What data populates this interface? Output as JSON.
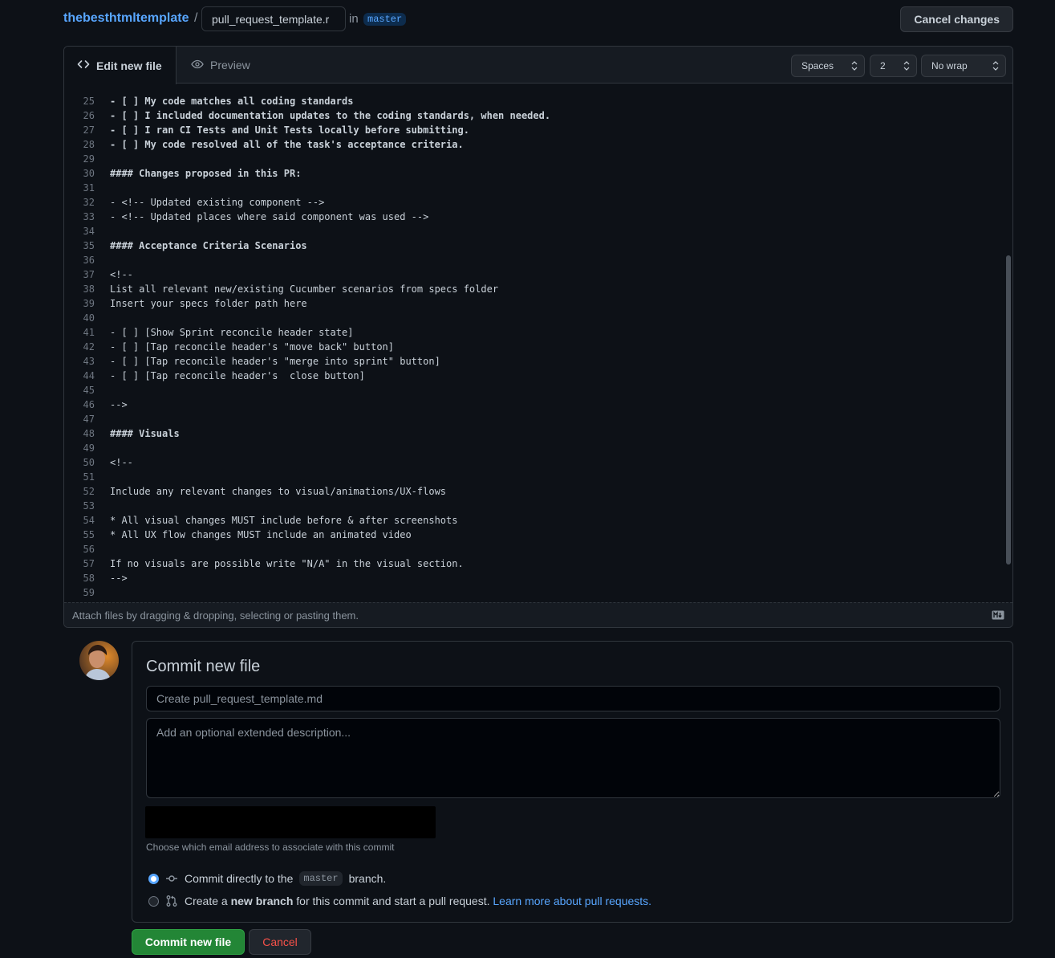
{
  "breadcrumb": {
    "repo": "thebesthtmltemplate",
    "separator": "/",
    "filename_value": "pull_request_template.r",
    "in_label": "in",
    "branch": "master"
  },
  "header": {
    "cancel_changes": "Cancel changes"
  },
  "editor": {
    "tab_edit": "Edit new file",
    "tab_preview": "Preview",
    "indent_mode": "Spaces",
    "indent_size": "2",
    "wrap_mode": "No wrap",
    "lines": [
      {
        "n": "25",
        "t": "- [ ] My code matches all coding standards",
        "bold": true
      },
      {
        "n": "26",
        "t": "- [ ] I included documentation updates to the coding standards, when needed.",
        "bold": true
      },
      {
        "n": "27",
        "t": "- [ ] I ran CI Tests and Unit Tests locally before submitting.",
        "bold": true
      },
      {
        "n": "28",
        "t": "- [ ] My code resolved all of the task's acceptance criteria.",
        "bold": true
      },
      {
        "n": "29",
        "t": ""
      },
      {
        "n": "30",
        "t": "#### Changes proposed in this PR:",
        "bold": true
      },
      {
        "n": "31",
        "t": ""
      },
      {
        "n": "32",
        "t": "- <!-- Updated existing component -->"
      },
      {
        "n": "33",
        "t": "- <!-- Updated places where said component was used -->"
      },
      {
        "n": "34",
        "t": ""
      },
      {
        "n": "35",
        "t": "#### Acceptance Criteria Scenarios",
        "bold": true
      },
      {
        "n": "36",
        "t": ""
      },
      {
        "n": "37",
        "t": "<!--"
      },
      {
        "n": "38",
        "t": "List all relevant new/existing Cucumber scenarios from specs folder"
      },
      {
        "n": "39",
        "t": "Insert your specs folder path here"
      },
      {
        "n": "40",
        "t": ""
      },
      {
        "n": "41",
        "t": "- [ ] [Show Sprint reconcile header state]"
      },
      {
        "n": "42",
        "t": "- [ ] [Tap reconcile header's \"move back\" button]"
      },
      {
        "n": "43",
        "t": "- [ ] [Tap reconcile header's \"merge into sprint\" button]"
      },
      {
        "n": "44",
        "t": "- [ ] [Tap reconcile header's  close button]"
      },
      {
        "n": "45",
        "t": ""
      },
      {
        "n": "46",
        "t": "-->"
      },
      {
        "n": "47",
        "t": ""
      },
      {
        "n": "48",
        "t": "#### Visuals",
        "bold": true
      },
      {
        "n": "49",
        "t": ""
      },
      {
        "n": "50",
        "t": "<!--"
      },
      {
        "n": "51",
        "t": ""
      },
      {
        "n": "52",
        "t": "Include any relevant changes to visual/animations/UX-flows"
      },
      {
        "n": "53",
        "t": ""
      },
      {
        "n": "54",
        "t": "* All visual changes MUST include before & after screenshots"
      },
      {
        "n": "55",
        "t": "* All UX flow changes MUST include an animated video"
      },
      {
        "n": "56",
        "t": ""
      },
      {
        "n": "57",
        "t": "If no visuals are possible write \"N/A\" in the visual section."
      },
      {
        "n": "58",
        "t": "-->"
      },
      {
        "n": "59",
        "t": ""
      }
    ],
    "attach_hint": "Attach files by dragging & dropping, selecting or pasting them."
  },
  "commit": {
    "title": "Commit new file",
    "summary_placeholder": "Create pull_request_template.md",
    "description_placeholder": "Add an optional extended description...",
    "email_note": "Choose which email address to associate with this commit",
    "option_direct_pre": "Commit directly to the",
    "option_direct_branch": "master",
    "option_direct_post": "branch.",
    "option_new_pre": "Create a",
    "option_new_bold": "new branch",
    "option_new_post": "for this commit and start a pull request.",
    "option_new_link": "Learn more about pull requests.",
    "commit_button": "Commit new file",
    "cancel_button": "Cancel"
  },
  "colors": {
    "background": "#0d1117",
    "link": "#58a6ff",
    "primary_button": "#238636",
    "danger_text": "#f85149"
  }
}
